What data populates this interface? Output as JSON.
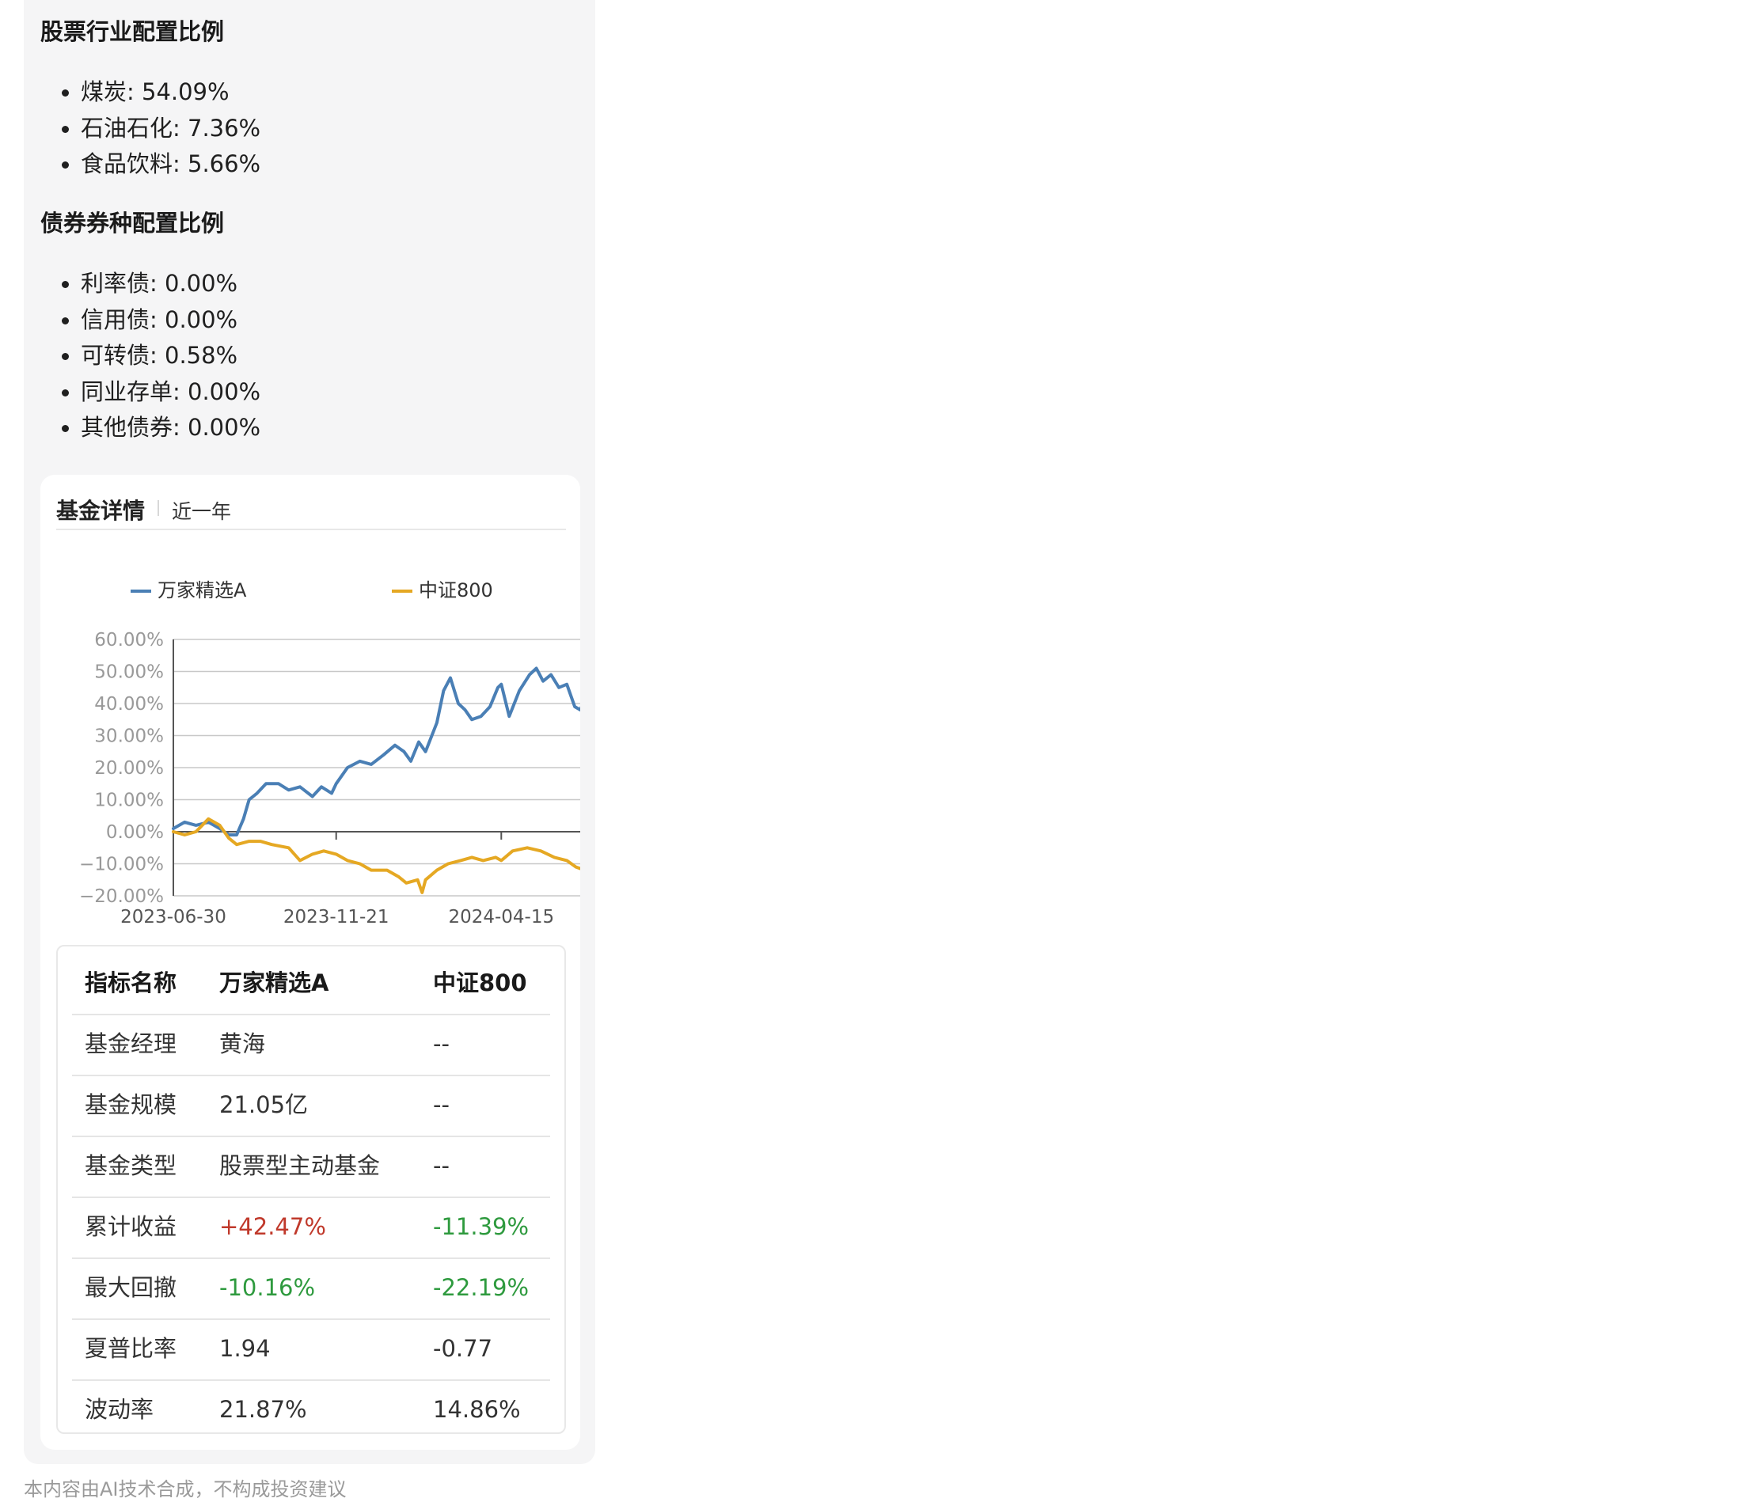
{
  "stock_section": {
    "title": "股票行业配置比例",
    "items": [
      "煤炭: 54.09%",
      "石油石化: 7.36%",
      "食品饮料: 5.66%"
    ]
  },
  "bond_section": {
    "title": "债券券种配置比例",
    "items": [
      "利率债: 0.00%",
      "信用债: 0.00%",
      "可转债: 0.58%",
      "同业存单: 0.00%",
      "其他债券: 0.00%"
    ]
  },
  "card": {
    "title": "基金详情",
    "range": "近一年"
  },
  "colors": {
    "fund": "#4a7fb5",
    "index": "#e5a823",
    "positive": "#c0392b",
    "negative": "#2e9a3e"
  },
  "chart_data": {
    "type": "line",
    "x_ticks": [
      "2023-06-30",
      "2023-11-21",
      "2024-04-15"
    ],
    "x_range": [
      "2023-06-30",
      "2024-06-28"
    ],
    "y_ticks": [
      "60.00%",
      "50.00%",
      "40.00%",
      "30.00%",
      "20.00%",
      "10.00%",
      "0.00%",
      "−10.00%",
      "−20.00%"
    ],
    "ylim": [
      -20,
      60
    ],
    "grid": true,
    "legend": "top",
    "series": [
      {
        "name": "万家精选A",
        "points": [
          [
            "2023-06-30",
            1
          ],
          [
            "2023-07-10",
            3
          ],
          [
            "2023-07-20",
            2
          ],
          [
            "2023-07-31",
            3
          ],
          [
            "2023-08-10",
            1
          ],
          [
            "2023-08-18",
            -1
          ],
          [
            "2023-08-25",
            -1
          ],
          [
            "2023-08-31",
            4
          ],
          [
            "2023-09-05",
            10
          ],
          [
            "2023-09-12",
            12
          ],
          [
            "2023-09-20",
            15
          ],
          [
            "2023-10-01",
            15
          ],
          [
            "2023-10-10",
            13
          ],
          [
            "2023-10-20",
            14
          ],
          [
            "2023-10-31",
            11
          ],
          [
            "2023-11-08",
            14
          ],
          [
            "2023-11-17",
            12
          ],
          [
            "2023-11-21",
            15
          ],
          [
            "2023-12-01",
            20
          ],
          [
            "2023-12-12",
            22
          ],
          [
            "2023-12-22",
            21
          ],
          [
            "2024-01-02",
            24
          ],
          [
            "2024-01-12",
            27
          ],
          [
            "2024-01-20",
            25
          ],
          [
            "2024-01-26",
            22
          ],
          [
            "2024-02-02",
            28
          ],
          [
            "2024-02-08",
            25
          ],
          [
            "2024-02-18",
            34
          ],
          [
            "2024-02-24",
            44
          ],
          [
            "2024-03-01",
            48
          ],
          [
            "2024-03-08",
            40
          ],
          [
            "2024-03-14",
            38
          ],
          [
            "2024-03-20",
            35
          ],
          [
            "2024-03-28",
            36
          ],
          [
            "2024-04-05",
            39
          ],
          [
            "2024-04-12",
            45
          ],
          [
            "2024-04-15",
            46
          ],
          [
            "2024-04-22",
            36
          ],
          [
            "2024-05-01",
            44
          ],
          [
            "2024-05-10",
            49
          ],
          [
            "2024-05-16",
            51
          ],
          [
            "2024-05-22",
            47
          ],
          [
            "2024-05-29",
            49
          ],
          [
            "2024-06-05",
            45
          ],
          [
            "2024-06-12",
            46
          ],
          [
            "2024-06-19",
            39
          ],
          [
            "2024-06-24",
            38
          ],
          [
            "2024-06-28",
            42
          ]
        ]
      },
      {
        "name": "中证800",
        "points": [
          [
            "2023-06-30",
            0
          ],
          [
            "2023-07-10",
            -1
          ],
          [
            "2023-07-20",
            0
          ],
          [
            "2023-07-31",
            4
          ],
          [
            "2023-08-10",
            2
          ],
          [
            "2023-08-18",
            -2
          ],
          [
            "2023-08-25",
            -4
          ],
          [
            "2023-09-05",
            -3
          ],
          [
            "2023-09-15",
            -3
          ],
          [
            "2023-09-25",
            -4
          ],
          [
            "2023-10-10",
            -5
          ],
          [
            "2023-10-20",
            -9
          ],
          [
            "2023-10-31",
            -7
          ],
          [
            "2023-11-10",
            -6
          ],
          [
            "2023-11-21",
            -7
          ],
          [
            "2023-12-01",
            -9
          ],
          [
            "2023-12-12",
            -10
          ],
          [
            "2023-12-22",
            -12
          ],
          [
            "2024-01-05",
            -12
          ],
          [
            "2024-01-15",
            -14
          ],
          [
            "2024-01-22",
            -16
          ],
          [
            "2024-02-01",
            -15
          ],
          [
            "2024-02-05",
            -19
          ],
          [
            "2024-02-08",
            -15
          ],
          [
            "2024-02-18",
            -12
          ],
          [
            "2024-02-28",
            -10
          ],
          [
            "2024-03-10",
            -9
          ],
          [
            "2024-03-20",
            -8
          ],
          [
            "2024-03-30",
            -9
          ],
          [
            "2024-04-10",
            -8
          ],
          [
            "2024-04-15",
            -9
          ],
          [
            "2024-04-25",
            -6
          ],
          [
            "2024-05-08",
            -5
          ],
          [
            "2024-05-20",
            -6
          ],
          [
            "2024-06-01",
            -8
          ],
          [
            "2024-06-12",
            -9
          ],
          [
            "2024-06-20",
            -11
          ],
          [
            "2024-06-28",
            -12
          ]
        ]
      }
    ]
  },
  "metrics": {
    "headers": [
      "指标名称",
      "万家精选A",
      "中证800"
    ],
    "rows": [
      {
        "label": "基金经理",
        "fund": "黄海",
        "index": "--",
        "fund_tone": "",
        "index_tone": ""
      },
      {
        "label": "基金规模",
        "fund": "21.05亿",
        "index": "--",
        "fund_tone": "",
        "index_tone": ""
      },
      {
        "label": "基金类型",
        "fund": "股票型主动基金",
        "index": "--",
        "fund_tone": "",
        "index_tone": ""
      },
      {
        "label": "累计收益",
        "fund": "+42.47%",
        "index": "-11.39%",
        "fund_tone": "pos",
        "index_tone": "neg"
      },
      {
        "label": "最大回撤",
        "fund": "-10.16%",
        "index": "-22.19%",
        "fund_tone": "neg",
        "index_tone": "neg"
      },
      {
        "label": "夏普比率",
        "fund": "1.94",
        "index": "-0.77",
        "fund_tone": "",
        "index_tone": ""
      },
      {
        "label": "波动率",
        "fund": "21.87%",
        "index": "14.86%",
        "fund_tone": "",
        "index_tone": ""
      }
    ]
  },
  "footer": "本内容由AI技术合成，不构成投资建议"
}
